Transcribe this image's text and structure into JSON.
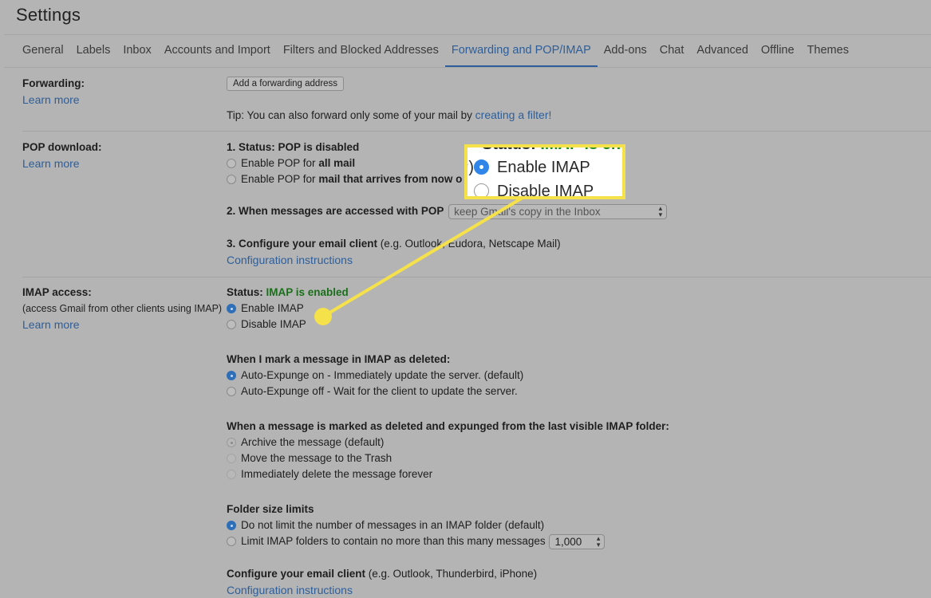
{
  "page": {
    "title": "Settings"
  },
  "tabs": [
    {
      "label": "General",
      "active": false
    },
    {
      "label": "Labels",
      "active": false
    },
    {
      "label": "Inbox",
      "active": false
    },
    {
      "label": "Accounts and Import",
      "active": false
    },
    {
      "label": "Filters and Blocked Addresses",
      "active": false
    },
    {
      "label": "Forwarding and POP/IMAP",
      "active": true
    },
    {
      "label": "Add-ons",
      "active": false
    },
    {
      "label": "Chat",
      "active": false
    },
    {
      "label": "Advanced",
      "active": false
    },
    {
      "label": "Offline",
      "active": false
    },
    {
      "label": "Themes",
      "active": false
    }
  ],
  "forwarding": {
    "label": "Forwarding:",
    "learn_more": "Learn more",
    "add_button": "Add a forwarding address",
    "tip_prefix": "Tip: You can also forward only some of your mail by ",
    "tip_link": "creating a filter!"
  },
  "pop": {
    "label": "POP download:",
    "learn_more": "Learn more",
    "status": "1. Status: POP is disabled",
    "opt_all_prefix": "Enable POP for ",
    "opt_all_bold": "all mail",
    "opt_now_prefix": "Enable POP for ",
    "opt_now_bold": "mail that arrives from now o",
    "accessed_label": "2. When messages are accessed with POP",
    "accessed_select": "keep Gmail's copy in the Inbox",
    "configure_bold": "3. Configure your email client",
    "configure_rest": " (e.g. Outlook, Eudora, Netscape Mail)",
    "config_link": "Configuration instructions"
  },
  "imap": {
    "label": "IMAP access:",
    "sublabel": "(access Gmail from other clients using IMAP)",
    "learn_more": "Learn more",
    "status_prefix": "Status: ",
    "status_value": "IMAP is enabled",
    "enable": "Enable IMAP",
    "disable": "Disable IMAP",
    "enabled": true,
    "deleted_heading": "When I mark a message in IMAP as deleted:",
    "expunge_on": "Auto-Expunge on - Immediately update the server. (default)",
    "expunge_off": "Auto-Expunge off - Wait for the client to update the server.",
    "expunged_heading": "When a message is marked as deleted and expunged from the last visible IMAP folder:",
    "archive": "Archive the message (default)",
    "trash": "Move the message to the Trash",
    "delete_forever": "Immediately delete the message forever",
    "folder_heading": "Folder size limits",
    "no_limit": "Do not limit the number of messages in an IMAP folder (default)",
    "limit": "Limit IMAP folders to contain no more than this many messages",
    "limit_value": "1,000",
    "configure_bold": "Configure your email client",
    "configure_rest": " (e.g. Outlook, Thunderbird, iPhone)",
    "config_link": "Configuration instructions"
  },
  "callout": {
    "status_prefix": "Status: ",
    "status_value": "IMAP is en",
    "prefix": "P)",
    "enable": "Enable IMAP",
    "disable": "Disable IMAP"
  },
  "colors": {
    "accent": "#2d5e9a",
    "enabled_green": "#1b6f1b",
    "highlight_yellow": "#f5e14a",
    "radio_selected": "#2f6fb8"
  }
}
